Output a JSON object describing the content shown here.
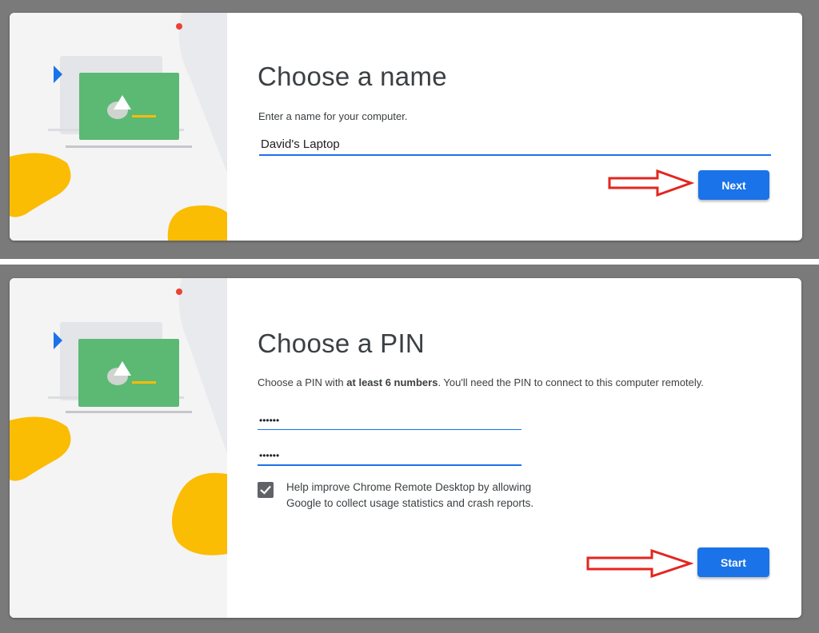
{
  "colors": {
    "accent": "#1a73e8",
    "arrow": "#e3261f",
    "illustration_green": "#5bb974",
    "illustration_yellow": "#fbbc04",
    "illustration_blue": "#1a73e8",
    "illustration_red": "#ea4335"
  },
  "icons": {
    "illustration": "laptop-illustration",
    "arrow": "red-outline-arrow-icon",
    "checkbox": "check-icon"
  },
  "name_step": {
    "title": "Choose a name",
    "description": "Enter a name for your computer.",
    "name_value": "David's Laptop",
    "next_label": "Next"
  },
  "pin_step": {
    "title": "Choose a PIN",
    "description_pre": "Choose a PIN with ",
    "description_bold": "at least 6 numbers",
    "description_post": ". You'll need the PIN to connect to this computer remotely.",
    "pin_value": "••••••",
    "pin_confirm_value": "••••••",
    "checkbox_checked": true,
    "checkbox_label": "Help improve Chrome Remote Desktop by allowing Google to collect usage statistics and crash reports.",
    "start_label": "Start"
  }
}
